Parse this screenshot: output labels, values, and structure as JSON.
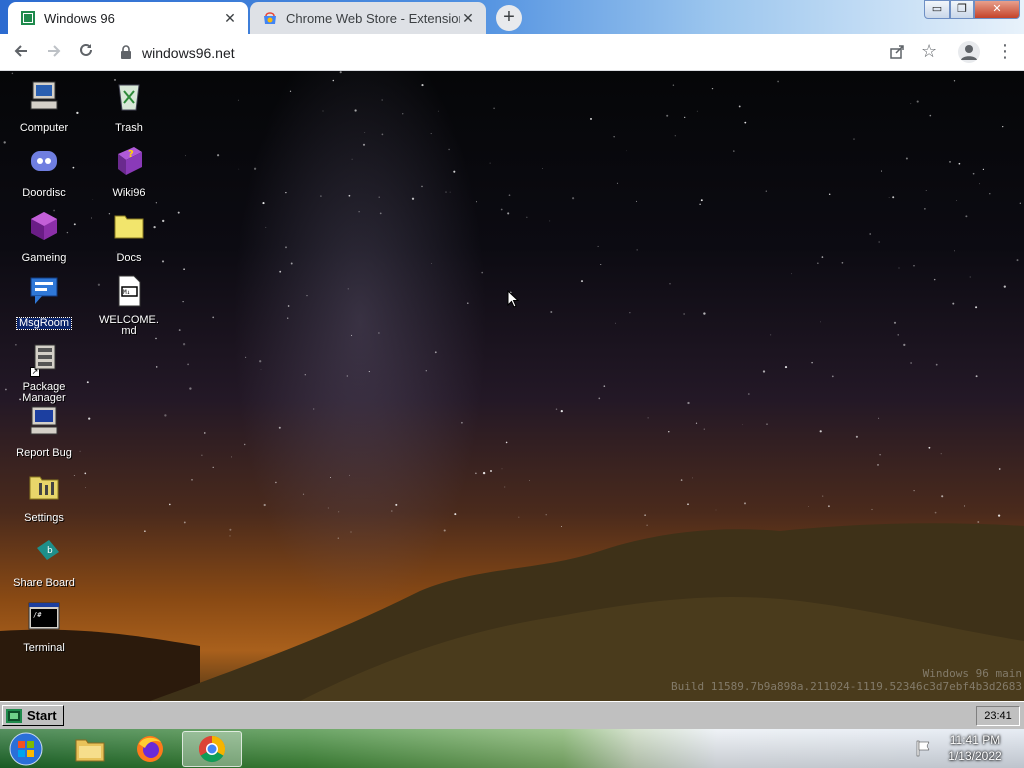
{
  "browser": {
    "tabs": [
      {
        "title": "Windows 96",
        "active": true
      },
      {
        "title": "Chrome Web Store - Extensions",
        "active": false
      }
    ],
    "new_tab_label": "+",
    "url": "windows96.net",
    "window_controls": {
      "minimize": "▭",
      "maximize": "❐",
      "close": "✕"
    }
  },
  "desktop": {
    "icons": [
      {
        "label": "Computer",
        "icon": "computer-icon"
      },
      {
        "label": "Doordisc",
        "icon": "discord-icon"
      },
      {
        "label": "Gameing",
        "icon": "game-cube-icon"
      },
      {
        "label": "MsgRoom",
        "icon": "chat-icon",
        "selected": true
      },
      {
        "label": "Package Manager",
        "icon": "package-icon"
      },
      {
        "label": "Report Bug",
        "icon": "bug-report-icon"
      },
      {
        "label": "Settings",
        "icon": "settings-icon"
      },
      {
        "label": "Share Board",
        "icon": "share-board-icon"
      },
      {
        "label": "Terminal",
        "icon": "terminal-icon"
      },
      {
        "label": "Trash",
        "icon": "trash-icon"
      },
      {
        "label": "Wiki96",
        "icon": "wiki-book-icon"
      },
      {
        "label": "Docs",
        "icon": "folder-icon"
      },
      {
        "label": "WELCOME.md",
        "icon": "markdown-file-icon"
      }
    ],
    "watermark": {
      "line1": "Windows 96 main",
      "line2": "Build 11589.7b9a898a.211024-1119.52346c3d7ebf4b3d2683"
    }
  },
  "w96_taskbar": {
    "start_label": "Start",
    "clock": "23:41"
  },
  "os_taskbar": {
    "apps": [
      "file-explorer-icon",
      "firefox-icon",
      "chrome-icon"
    ],
    "time": "11:41 PM",
    "date": "1/13/2022"
  },
  "colors": {
    "selection": "#0a246a",
    "win96_gray": "#c0c0c0",
    "chrome_accent": "#1a73e8"
  }
}
